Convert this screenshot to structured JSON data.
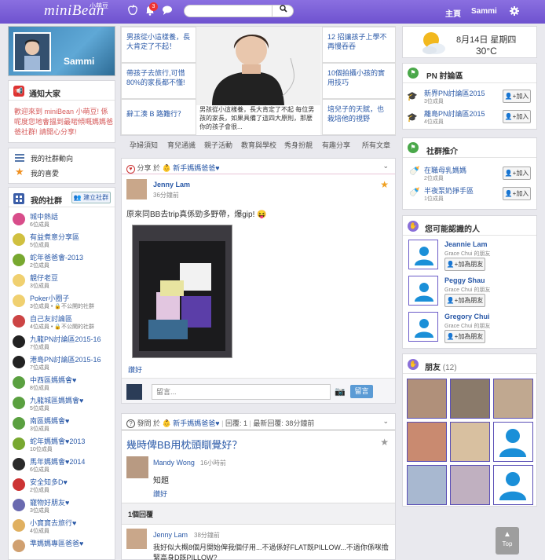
{
  "header": {
    "logo": "miniBean",
    "logo_sub": "小萌豆",
    "notification_count": "3",
    "search_placeholder": "",
    "home": "主頁",
    "user": "Sammi"
  },
  "profile": {
    "name": "Sammi"
  },
  "announce": {
    "title": "通知大家",
    "body": "歡迎來到 miniBean 小萌豆! 係呢度您地會搵到最啱傾嘅媽媽爸爸社群! 請開心分享!"
  },
  "my_links": [
    {
      "label": "我的社群動向"
    },
    {
      "label": "我的喜愛"
    }
  ],
  "my_groups": {
    "title": "我的社群",
    "create": "建立社群",
    "items": [
      {
        "name": "城中熱話",
        "meta": "6位成員",
        "color": "#d84d8a"
      },
      {
        "name": "有益煮意分享區",
        "meta": "5位成員",
        "color": "#d0c040"
      },
      {
        "name": "蛇年爸爸會-2013",
        "meta": "2位成員",
        "color": "#78a830"
      },
      {
        "name": "靚仔老豆",
        "meta": "3位成員",
        "color": "#f0d070"
      },
      {
        "name": "Poker小圈子",
        "meta": "3位成員 • 🔒不公開的社群",
        "color": "#f0d070"
      },
      {
        "name": "自己友討論區",
        "meta": "4位成員 • 🔒不公開的社群",
        "color": "#c44"
      },
      {
        "name": "九龍PN討論區2015-16",
        "meta": "7位成員",
        "color": "#222"
      },
      {
        "name": "港島PN討論區2015-16",
        "meta": "7位成員",
        "color": "#222"
      },
      {
        "name": "中西區媽媽會♥",
        "meta": "8位成員",
        "color": "#5aa040"
      },
      {
        "name": "九龍城區媽媽會♥",
        "meta": "5位成員",
        "color": "#5aa040"
      },
      {
        "name": "南區媽媽會♥",
        "meta": "3位成員",
        "color": "#5aa040"
      },
      {
        "name": "蛇年媽媽會♥2013",
        "meta": "10位成員",
        "color": "#78a830"
      },
      {
        "name": "馬年媽媽會♥2014",
        "meta": "6位成員",
        "color": "#2a2a2a"
      },
      {
        "name": "安全知多D♥",
        "meta": "2位成員",
        "color": "#c33"
      },
      {
        "name": "寵物好朋友♥",
        "meta": "3位成員",
        "color": "#6a6ab0"
      },
      {
        "name": "小寶寶去旅行♥",
        "meta": "4位成員",
        "color": "#e0b060"
      },
      {
        "name": "準媽媽專區爸爸♥",
        "meta": "",
        "color": "#d0a070"
      }
    ]
  },
  "featured": {
    "cells": [
      {
        "text": "男孩從小這樣養，長大肯定了不起！"
      },
      {
        "text": "12 招讓孩子上學不再慢吞吞"
      },
      {
        "text": "帶孩子去旅行,可惜80%的家長都不懂!"
      },
      {
        "text": "10個拍攝小孩的實用技巧"
      },
      {
        "text": "辭工湊 B 路難行？"
      },
      {
        "text": "培兒子的天賦，也栽培他的視野"
      }
    ],
    "center_caption": "男孩從小這樣養，長大肯定了不起 每位男孩的家長，如果具備了這四大原則，那麼你的孩子會很..."
  },
  "tabs": [
    "孕婦須知",
    "育兒通識",
    "親子活動",
    "教育與學校",
    "秀身扮靚",
    "有趣分享",
    "所有文章"
  ],
  "post1": {
    "type": "分享 於",
    "group": "新手媽媽爸爸♥",
    "author": "Jenny Lam",
    "time": "36分鐘前",
    "body": "原來同BB去trip真係勁多野帶，爆gip!",
    "like": "讚好",
    "comment_placeholder": "留言...",
    "comment_btn": "留言"
  },
  "post2": {
    "type": "發問 於",
    "group": "新手媽媽爸爸♥",
    "reply_count": "回覆: 1",
    "latest": "最新回覆: 38分鐘前",
    "title": "幾時俾BB用枕頭瞓覺好？",
    "author": "Mandy Wong",
    "time": "16小時前",
    "body": "知題",
    "like": "讚好",
    "replies_label": "1個回覆",
    "reply_author": "Jenny Lam",
    "reply_time": "38分鐘前",
    "reply_body": "我好似大概8個月開始俾我個仔用...不過係好FLAT既PILLOW...不過你係咪擔緊高身D既PILLOW?"
  },
  "weather": {
    "date": "8月14日 星期四",
    "temp": "30°C"
  },
  "pn": {
    "title": "PN 討論區",
    "items": [
      {
        "name": "新界PN討論區2015",
        "meta": "3位成員",
        "btn": "加入"
      },
      {
        "name": "離島PN討論區2015",
        "meta": "4位成員",
        "btn": "加入"
      }
    ]
  },
  "recommend": {
    "title": "社群推介",
    "items": [
      {
        "name": "在職母乳媽媽",
        "meta": "2位成員",
        "btn": "加入"
      },
      {
        "name": "半夜泵奶掙手區",
        "meta": "1位成員",
        "btn": "加入"
      }
    ]
  },
  "people": {
    "title": "您可能認識的人",
    "items": [
      {
        "name": "Jeannie Lam",
        "sub": "Grace Chui 的朋友",
        "btn": "加為朋友"
      },
      {
        "name": "Peggy Shau",
        "sub": "Grace Chui 的朋友",
        "btn": "加為朋友"
      },
      {
        "name": "Gregory Chui",
        "sub": "Grace Chui 的朋友",
        "btn": "加為朋友"
      }
    ]
  },
  "friends": {
    "title": "朋友",
    "count": "(12)"
  },
  "top_btn": "Top"
}
